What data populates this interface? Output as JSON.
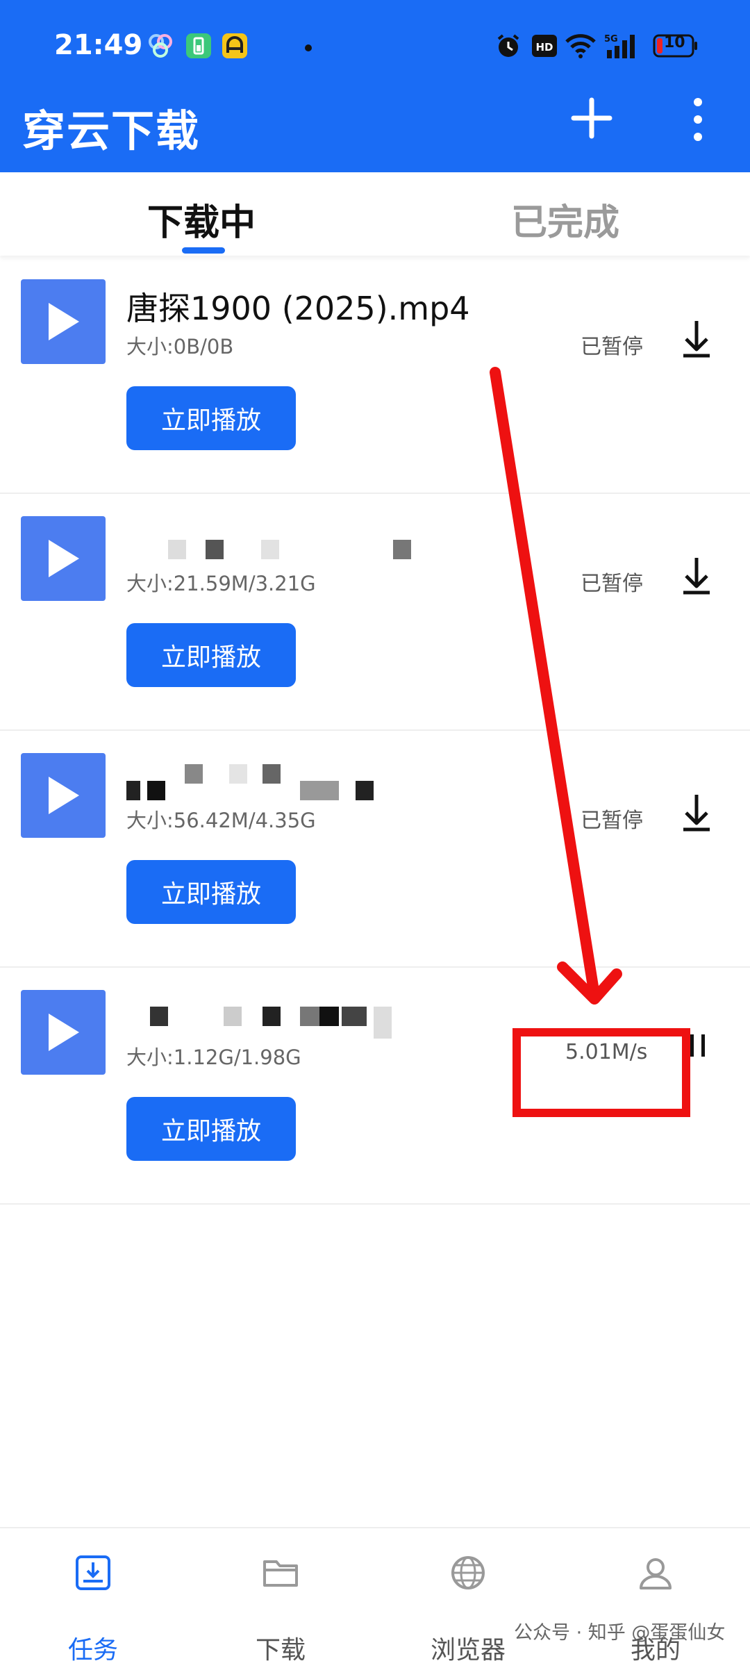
{
  "status_bar": {
    "time": "21:49",
    "icons": [
      "app-icon",
      "battery-app-icon",
      "assistant-app-icon",
      "dot-icon",
      "alarm-icon",
      "hd-icon",
      "wifi-icon",
      "signal-5g-icon",
      "battery-icon"
    ],
    "battery_level": "10"
  },
  "header": {
    "title": "穿云下载",
    "actions": [
      "plus-icon",
      "more-vertical-icon"
    ]
  },
  "tabs": [
    {
      "label": "下载中",
      "active": true
    },
    {
      "label": "已完成",
      "active": false
    }
  ],
  "downloads": [
    {
      "title": "唐探1900 (2025).mp4",
      "size": "大小:0B/0B",
      "status": "已暂停",
      "action_icon": "download-icon",
      "play_label": "立即播放"
    },
    {
      "title": "",
      "size": "大小:21.59M/3.21G",
      "status": "已暂停",
      "action_icon": "download-icon",
      "play_label": "立即播放"
    },
    {
      "title": "",
      "size": "大小:56.42M/4.35G",
      "status": "已暂停",
      "action_icon": "download-icon",
      "play_label": "立即播放"
    },
    {
      "title": "",
      "size": "大小:1.12G/1.98G",
      "status": "5.01M/s",
      "action_icon": "pause-icon",
      "play_label": "立即播放"
    }
  ],
  "annotation": {
    "color": "#ee1111"
  },
  "bottom_nav": [
    {
      "label": "任务",
      "icon": "task-download-icon",
      "active": true
    },
    {
      "label": "下载",
      "icon": "folder-icon",
      "active": false
    },
    {
      "label": "浏览器",
      "icon": "globe-icon",
      "active": false
    },
    {
      "label": "我的",
      "icon": "user-icon",
      "active": false
    }
  ],
  "watermark": "公众号 · 知乎 @蛋蛋仙女",
  "colors": {
    "primary": "#1a6cf5",
    "thumb": "#4c7df0",
    "annotation": "#ee1111"
  }
}
